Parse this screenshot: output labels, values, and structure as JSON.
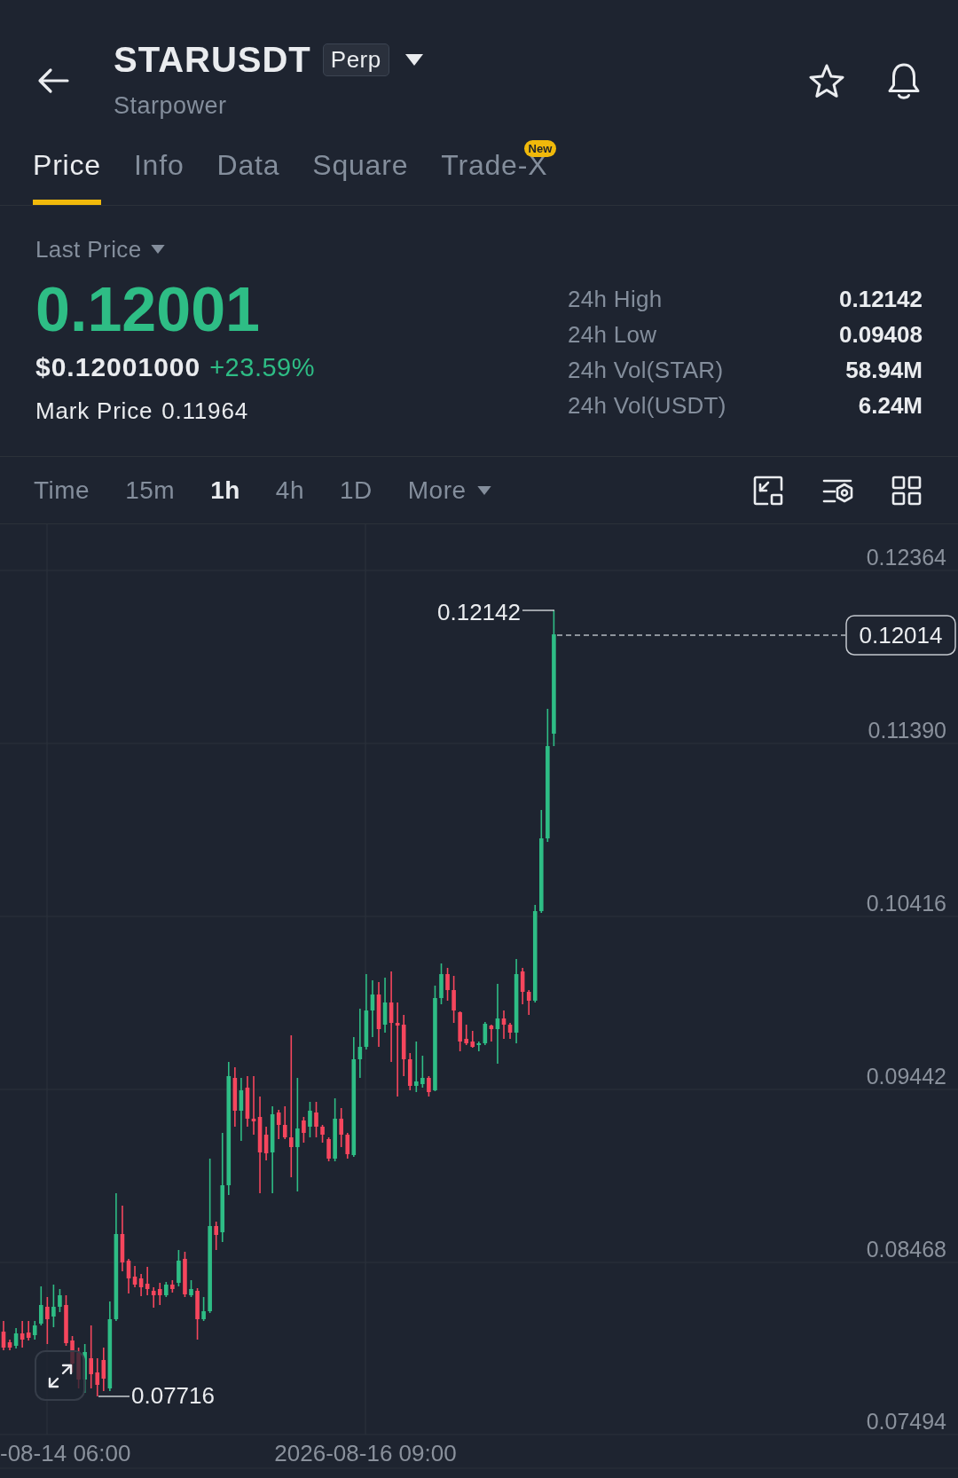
{
  "header": {
    "symbol": "STARUSDT",
    "contract_type": "Perp",
    "name": "Starpower"
  },
  "tabs": [
    {
      "label": "Price",
      "selected": true
    },
    {
      "label": "Info",
      "selected": false
    },
    {
      "label": "Data",
      "selected": false
    },
    {
      "label": "Square",
      "selected": false
    },
    {
      "label": "Trade-X",
      "selected": false,
      "badge": "New"
    }
  ],
  "price_panel": {
    "price_type": "Last Price",
    "last_price": "0.12001",
    "usd_price": "$0.12001000",
    "change": "+23.59%",
    "mark_price": {
      "label": "Mark Price",
      "value": "0.11964"
    },
    "stats": [
      {
        "label": "24h High",
        "value": "0.12142"
      },
      {
        "label": "24h Low",
        "value": "0.09408"
      },
      {
        "label": "24h Vol(STAR)",
        "value": "58.94M"
      },
      {
        "label": "24h Vol(USDT)",
        "value": "6.24M"
      }
    ]
  },
  "intervals": [
    {
      "label": "Time",
      "kind": "option",
      "selected": false
    },
    {
      "label": "15m",
      "kind": "option",
      "selected": false
    },
    {
      "label": "1h",
      "kind": "option",
      "selected": true
    },
    {
      "label": "4h",
      "kind": "option",
      "selected": false
    },
    {
      "label": "1D",
      "kind": "option",
      "selected": false
    },
    {
      "label": "More",
      "kind": "menu",
      "selected": false
    }
  ],
  "chart": {
    "price_axis": [
      "0.12364",
      "0.11390",
      "0.10416",
      "0.09442",
      "0.08468",
      "0.07494"
    ],
    "time_axis": [
      "-08-14 06:00",
      "2026-08-16 09:00"
    ],
    "high_label": "0.12142",
    "low_label": "0.07716",
    "current_price": "0.12014"
  }
}
